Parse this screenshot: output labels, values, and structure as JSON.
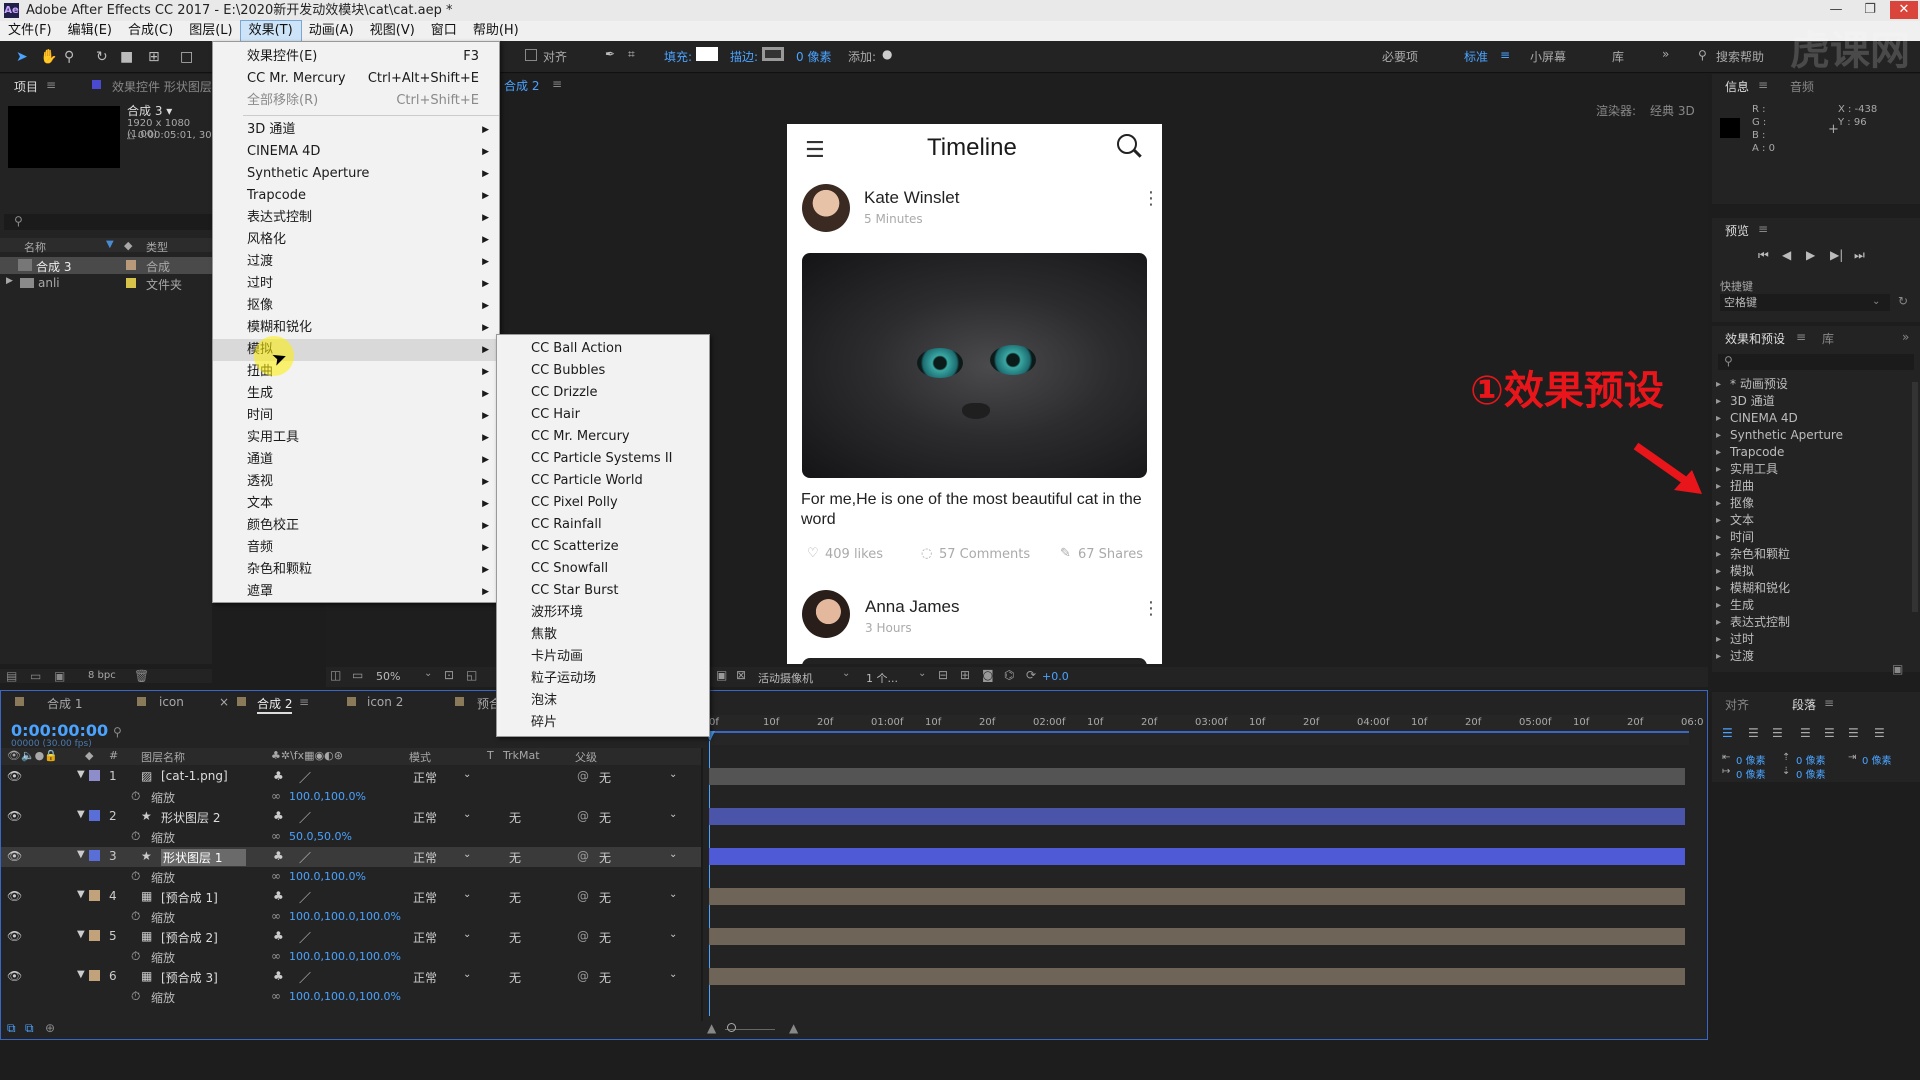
{
  "window": {
    "title": "Adobe After Effects CC 2017 - E:\\2020新开发动效模块\\cat\\cat.aep *",
    "min": "—",
    "max": "❐",
    "close": "✕"
  },
  "menubar": {
    "items": [
      "文件(F)",
      "编辑(E)",
      "合成(C)",
      "图层(L)",
      "效果(T)",
      "动画(A)",
      "视图(V)",
      "窗口",
      "帮助(H)"
    ]
  },
  "toolbar": {
    "align_label": "对齐",
    "fill_label": "填充:",
    "stroke_label": "描边:",
    "stroke_width": "0 像素",
    "add_label": "添加:",
    "workspaces": [
      "必要项",
      "标准",
      "小屏幕",
      "库"
    ],
    "search_help": "搜索帮助"
  },
  "project_panel": {
    "tab_project": "项目",
    "tab_effect_controls": "效果控件 形状图层",
    "comp_name": "合成 3 ▾",
    "comp_size": "1920 x 1080 (1.00)",
    "comp_duration": "△ 0:00:05:01, 30",
    "col_name": "名称",
    "col_type": "类型",
    "rows": [
      {
        "name": "合成 3",
        "type": "合成"
      },
      {
        "name": "anli",
        "type": "文件夹"
      }
    ],
    "bpc": "8 bpc"
  },
  "effects_menu": {
    "items": [
      {
        "label": "效果控件(E)",
        "shortcut": "F3"
      },
      {
        "label": "CC Mr. Mercury",
        "shortcut": "Ctrl+Alt+Shift+E"
      },
      {
        "label": "全部移除(R)",
        "shortcut": "Ctrl+Shift+E"
      },
      {
        "label": "3D 通道"
      },
      {
        "label": "CINEMA 4D"
      },
      {
        "label": "Synthetic Aperture"
      },
      {
        "label": "Trapcode"
      },
      {
        "label": "表达式控制"
      },
      {
        "label": "风格化"
      },
      {
        "label": "过渡"
      },
      {
        "label": "过时"
      },
      {
        "label": "抠像"
      },
      {
        "label": "模糊和锐化"
      },
      {
        "label": "模拟"
      },
      {
        "label": "扭曲"
      },
      {
        "label": "生成"
      },
      {
        "label": "时间"
      },
      {
        "label": "实用工具"
      },
      {
        "label": "通道"
      },
      {
        "label": "透视"
      },
      {
        "label": "文本"
      },
      {
        "label": "颜色校正"
      },
      {
        "label": "音频"
      },
      {
        "label": "杂色和颗粒"
      },
      {
        "label": "遮罩"
      }
    ]
  },
  "simulate_submenu": {
    "items": [
      "CC Ball Action",
      "CC Bubbles",
      "CC Drizzle",
      "CC Hair",
      "CC Mr. Mercury",
      "CC Particle Systems II",
      "CC Particle World",
      "CC Pixel Polly",
      "CC Rainfall",
      "CC Scatterize",
      "CC Snowfall",
      "CC Star Burst",
      "波形环境",
      "焦散",
      "卡片动画",
      "粒子运动场",
      "泡沫",
      "碎片"
    ]
  },
  "composition_panel": {
    "tab": "合成 2",
    "renderer_label": "渲染器:",
    "renderer_value": "经典 3D",
    "zoom": "50%",
    "camera": "活动摄像机",
    "views": "1 个...",
    "exposure": "+0.0"
  },
  "phone": {
    "title": "Timeline",
    "post1": {
      "name": "Kate Winslet",
      "time": "5 Minutes",
      "caption": "For me,He is one of the most beautiful cat in the word",
      "likes": "409 likes",
      "comments": "57 Comments",
      "shares": "67 Shares"
    },
    "post2": {
      "name": "Anna James",
      "time": "3 Hours"
    }
  },
  "info_panel": {
    "tab_info": "信息",
    "tab_audio": "音频",
    "r": "R :",
    "g": "G :",
    "b": "B :",
    "a": "A : 0",
    "x": "X : -438",
    "y": "Y : 96"
  },
  "preview_panel": {
    "tab": "预览",
    "shortcut_label": "快捷键",
    "shortcut_value": "空格键"
  },
  "effects_presets": {
    "tab": "效果和预设",
    "tab_library": "库",
    "items": [
      "* 动画预设",
      "3D 通道",
      "CINEMA 4D",
      "Synthetic Aperture",
      "Trapcode",
      "实用工具",
      "扭曲",
      "抠像",
      "文本",
      "时间",
      "杂色和颗粒",
      "模拟",
      "模糊和锐化",
      "生成",
      "表达式控制",
      "过时",
      "过渡"
    ]
  },
  "annotation": {
    "text": "①效果预设",
    "color": "#e8161b"
  },
  "align_panel": {
    "tab_align": "对齐",
    "tab_paragraph": "段落",
    "px": [
      "0 像素",
      "0 像素",
      "0 像素",
      "0 像素",
      "0 像素"
    ]
  },
  "timeline": {
    "tabs": [
      "合成 1",
      "icon",
      "合成 2",
      "icon 2",
      "预合"
    ],
    "timecode": "0:00:00:00",
    "fps": "00000 (30.00 fps)",
    "col_layer": "图层名称",
    "col_mode": "模式",
    "col_t": "T",
    "col_trkmat": "TrkMat",
    "col_parent": "父级",
    "ruler": [
      "0f",
      "10f",
      "20f",
      "01:00f",
      "10f",
      "20f",
      "02:00f",
      "10f",
      "20f",
      "03:00f",
      "10f",
      "20f",
      "04:00f",
      "10f",
      "20f",
      "05:00f",
      "10f",
      "20f",
      "06:0"
    ],
    "layers": [
      {
        "num": "1",
        "name": "[cat-1.png]",
        "mode": "正常",
        "trkmat": "",
        "parent": "无",
        "prop": "缩放",
        "value": "100.0,100.0%"
      },
      {
        "num": "2",
        "name": "形状图层 2",
        "mode": "正常",
        "trkmat": "无",
        "parent": "无",
        "prop": "缩放",
        "value": "50.0,50.0%"
      },
      {
        "num": "3",
        "name": "形状图层 1",
        "mode": "正常",
        "trkmat": "无",
        "parent": "无",
        "prop": "缩放",
        "value": "100.0,100.0%"
      },
      {
        "num": "4",
        "name": "[预合成 1]",
        "mode": "正常",
        "trkmat": "无",
        "parent": "无",
        "prop": "缩放",
        "value": "100.0,100.0,100.0%"
      },
      {
        "num": "5",
        "name": "[预合成 2]",
        "mode": "正常",
        "trkmat": "无",
        "parent": "无",
        "prop": "缩放",
        "value": "100.0,100.0,100.0%"
      },
      {
        "num": "6",
        "name": "[预合成 3]",
        "mode": "正常",
        "trkmat": "无",
        "parent": "无",
        "prop": "缩放",
        "value": "100.0,100.0,100.0%"
      }
    ]
  }
}
